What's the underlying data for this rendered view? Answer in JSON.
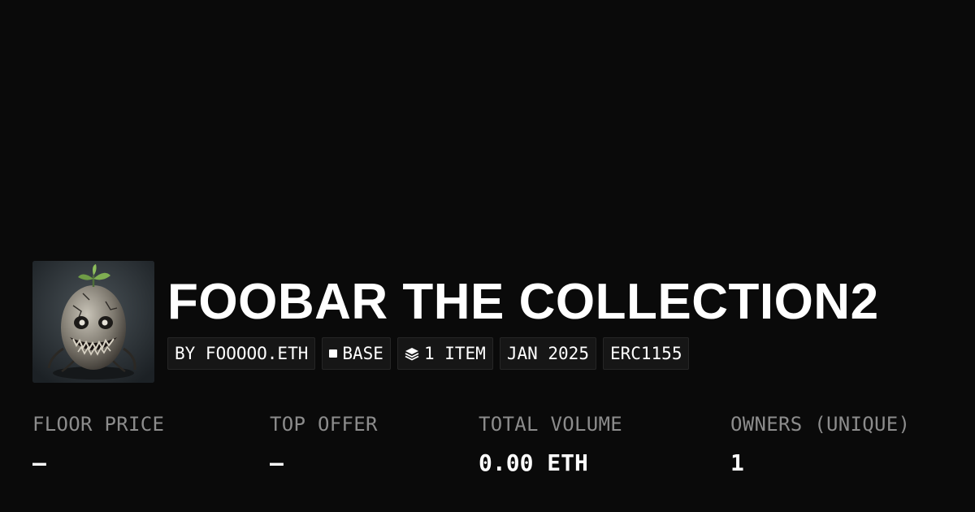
{
  "collection": {
    "title": "FOOBAR THE COLLECTION2"
  },
  "tags": {
    "creator": "BY FOOOOO.ETH",
    "chain": "BASE",
    "chain_icon": "square-icon",
    "items": "1 ITEM",
    "items_icon": "layers-icon",
    "date": "JAN 2025",
    "standard": "ERC1155"
  },
  "stats": [
    {
      "label": "FLOOR PRICE",
      "value": "—"
    },
    {
      "label": "TOP OFFER",
      "value": "—"
    },
    {
      "label": "TOTAL VOLUME",
      "value": "0.00 ETH"
    },
    {
      "label": "OWNERS (UNIQUE)",
      "value": "1"
    }
  ],
  "colors": {
    "background": "#0a0a0a",
    "text": "#ffffff",
    "muted": "#8c8c8c",
    "tag_bg": "#161616"
  }
}
